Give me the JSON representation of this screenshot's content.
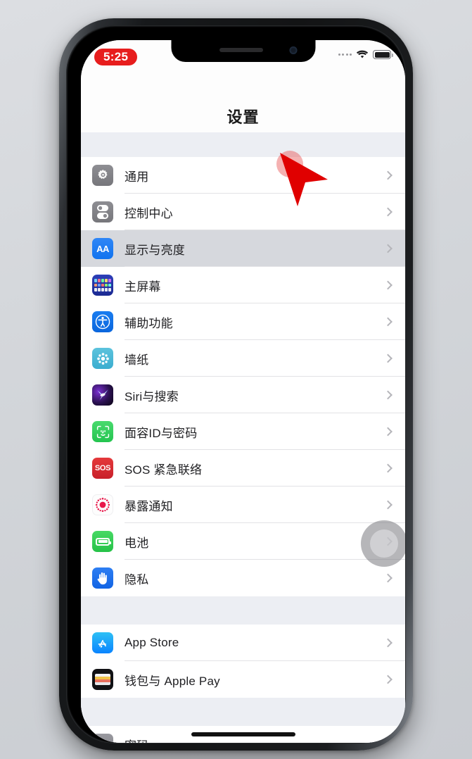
{
  "device": {
    "name": "iphone-x",
    "frame_color": "#17191b",
    "side_buttons": [
      "mute-switch",
      "volume-up",
      "volume-down",
      "power-button"
    ]
  },
  "status_bar": {
    "recording_time": "5:25",
    "recording_badge_color": "#e71d1d",
    "signal_dots": 4,
    "wifi_icon": "wifi-icon",
    "battery_icon": "battery-icon",
    "battery_level_percent": 88
  },
  "nav": {
    "title": "设置"
  },
  "groups": [
    {
      "name": "system-group",
      "rows": [
        {
          "label": "通用",
          "icon": "gear-icon",
          "icon_class": "ic-general",
          "selected": false
        },
        {
          "label": "控制中心",
          "icon": "control-center-icon",
          "icon_class": "ic-control",
          "selected": false
        },
        {
          "label": "显示与亮度",
          "icon": "display-aa-icon",
          "icon_class": "ic-display",
          "selected": true
        },
        {
          "label": "主屏幕",
          "icon": "home-screen-icon",
          "icon_class": "ic-home",
          "selected": false
        },
        {
          "label": "辅助功能",
          "icon": "accessibility-icon",
          "icon_class": "ic-access",
          "selected": false
        },
        {
          "label": "墙纸",
          "icon": "wallpaper-icon",
          "icon_class": "ic-wallpaper",
          "selected": false
        },
        {
          "label": "Siri与搜索",
          "icon": "siri-icon",
          "icon_class": "ic-siri",
          "selected": false
        },
        {
          "label": "面容ID与密码",
          "icon": "face-id-icon",
          "icon_class": "ic-faceid",
          "selected": false
        },
        {
          "label": "SOS 紧急联络",
          "icon": "sos-icon",
          "icon_class": "ic-sos",
          "selected": false
        },
        {
          "label": "暴露通知",
          "icon": "exposure-icon",
          "icon_class": "ic-exposure",
          "selected": false
        },
        {
          "label": "电池",
          "icon": "battery-icon",
          "icon_class": "ic-battery",
          "selected": false
        },
        {
          "label": "隐私",
          "icon": "privacy-hand-icon",
          "icon_class": "ic-privacy",
          "selected": false
        }
      ]
    },
    {
      "name": "store-group",
      "rows": [
        {
          "label": "App Store",
          "icon": "app-store-icon",
          "icon_class": "ic-appstore",
          "selected": false
        },
        {
          "label": "钱包与 Apple Pay",
          "icon": "wallet-icon",
          "icon_class": "ic-wallet",
          "selected": false
        }
      ]
    },
    {
      "name": "passwords-group",
      "rows": [
        {
          "label": "密码",
          "icon": "passwords-icon",
          "icon_class": "ic-passwords",
          "selected": false
        }
      ]
    }
  ],
  "overlays": {
    "assistive_touch": "assistive-touch-button",
    "cursor": "red-pointer-cursor",
    "tap_highlight_color": "#e84646",
    "cursor_color": "#e00000"
  },
  "colors": {
    "selected_row": "#d6d8dd",
    "group_background": "#eceef3",
    "row_background": "#ffffff",
    "separator": "#e2e2e5",
    "label_text": "#212124",
    "chevron": "#b5b5ba"
  }
}
